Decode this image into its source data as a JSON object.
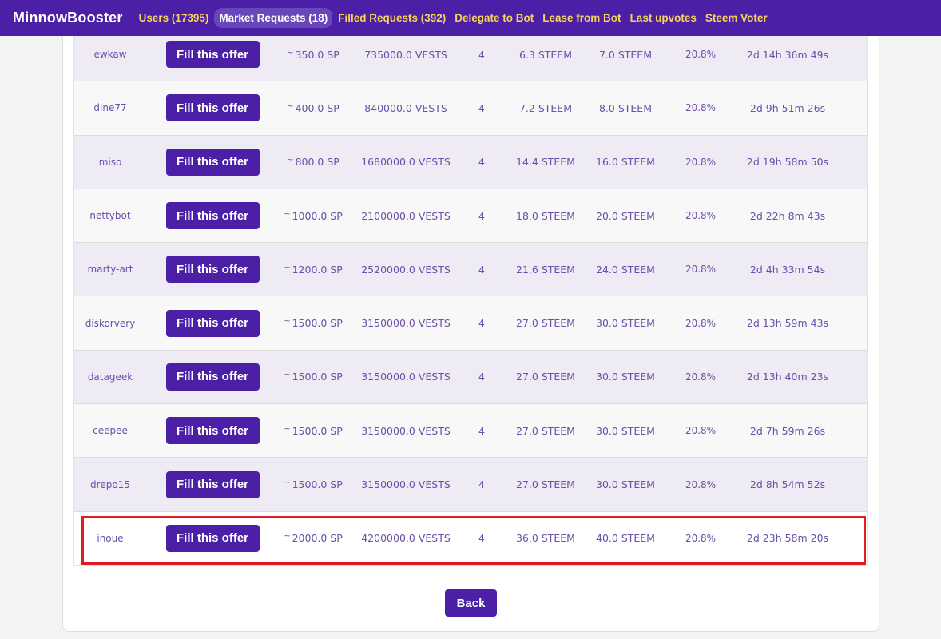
{
  "nav": {
    "brand": "MinnowBooster",
    "items": [
      {
        "label": "Users (17395)",
        "active": false
      },
      {
        "label": "Market Requests (18)",
        "active": true
      },
      {
        "label": "Filled Requests (392)",
        "active": false
      },
      {
        "label": "Delegate to Bot",
        "active": false
      },
      {
        "label": "Lease from Bot",
        "active": false
      },
      {
        "label": "Last upvotes",
        "active": false
      },
      {
        "label": "Steem Voter",
        "active": false
      }
    ]
  },
  "fill_label": "Fill this offer",
  "tilde": "~",
  "rows": [
    {
      "user": "ewkaw",
      "sp": "350.0 SP",
      "vests": "735000.0 VESTS",
      "n": "4",
      "s1": "6.3 STEEM",
      "s2": "7.0 STEEM",
      "pct": "20.8%",
      "time": "2d 14h 36m 49s"
    },
    {
      "user": "dine77",
      "sp": "400.0 SP",
      "vests": "840000.0 VESTS",
      "n": "4",
      "s1": "7.2 STEEM",
      "s2": "8.0 STEEM",
      "pct": "20.8%",
      "time": "2d 9h 51m 26s"
    },
    {
      "user": "miso",
      "sp": "800.0 SP",
      "vests": "1680000.0 VESTS",
      "n": "4",
      "s1": "14.4 STEEM",
      "s2": "16.0 STEEM",
      "pct": "20.8%",
      "time": "2d 19h 58m 50s"
    },
    {
      "user": "nettybot",
      "sp": "1000.0 SP",
      "vests": "2100000.0 VESTS",
      "n": "4",
      "s1": "18.0 STEEM",
      "s2": "20.0 STEEM",
      "pct": "20.8%",
      "time": "2d 22h 8m 43s"
    },
    {
      "user": "marty-art",
      "sp": "1200.0 SP",
      "vests": "2520000.0 VESTS",
      "n": "4",
      "s1": "21.6 STEEM",
      "s2": "24.0 STEEM",
      "pct": "20.8%",
      "time": "2d 4h 33m 54s"
    },
    {
      "user": "diskorvery",
      "sp": "1500.0 SP",
      "vests": "3150000.0 VESTS",
      "n": "4",
      "s1": "27.0 STEEM",
      "s2": "30.0 STEEM",
      "pct": "20.8%",
      "time": "2d 13h 59m 43s"
    },
    {
      "user": "datageek",
      "sp": "1500.0 SP",
      "vests": "3150000.0 VESTS",
      "n": "4",
      "s1": "27.0 STEEM",
      "s2": "30.0 STEEM",
      "pct": "20.8%",
      "time": "2d 13h 40m 23s"
    },
    {
      "user": "ceepee",
      "sp": "1500.0 SP",
      "vests": "3150000.0 VESTS",
      "n": "4",
      "s1": "27.0 STEEM",
      "s2": "30.0 STEEM",
      "pct": "20.8%",
      "time": "2d 7h 59m 26s"
    },
    {
      "user": "drepo15",
      "sp": "1500.0 SP",
      "vests": "3150000.0 VESTS",
      "n": "4",
      "s1": "27.0 STEEM",
      "s2": "30.0 STEEM",
      "pct": "20.8%",
      "time": "2d 8h 54m 52s"
    },
    {
      "user": "inoue",
      "sp": "2000.0 SP",
      "vests": "4200000.0 VESTS",
      "n": "4",
      "s1": "36.0 STEEM",
      "s2": "40.0 STEEM",
      "pct": "20.8%",
      "time": "2d 23h 58m 20s"
    }
  ],
  "back_label": "Back",
  "colors": {
    "brand": "#4b1fa6",
    "nav_link": "#f5d35e",
    "text": "#6b4fa8",
    "highlight": "#e01c24"
  }
}
